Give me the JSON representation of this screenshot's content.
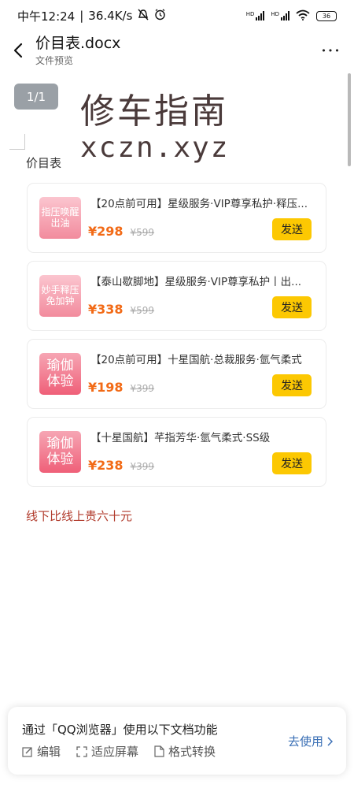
{
  "status_bar": {
    "time": "中午12:24",
    "speed": "36.4K/s",
    "hd1": "HD",
    "hd2": "HD",
    "battery": "36"
  },
  "app_bar": {
    "title": "价目表.docx",
    "subtitle": "文件预览",
    "more_label": "•••"
  },
  "document": {
    "page_indicator": "1/1",
    "watermark_cn": "修车指南",
    "watermark_en": "xczn.xyz",
    "heading": "价目表",
    "items": [
      {
        "thumb_text": "指压唤醒\n出油",
        "title": "【20点前可用】星级服务·VIP尊享私护·释压...",
        "price": "¥298",
        "original_price": "¥599",
        "button": "发送"
      },
      {
        "thumb_text": "妙手释压\n免加钟",
        "title": "【泰山歇脚地】星级服务·VIP尊享私护丨出...",
        "price": "¥338",
        "original_price": "¥599",
        "button": "发送"
      },
      {
        "thumb_text": "瑜伽\n体验",
        "title": "【20点前可用】十星国航·总裁服务·氫气柔式",
        "price": "¥198",
        "original_price": "¥399",
        "button": "发送"
      },
      {
        "thumb_text": "瑜伽\n体验",
        "title": "【十星国航】芊指芳华·氫气柔式·SS级",
        "price": "¥238",
        "original_price": "¥399",
        "button": "发送"
      }
    ],
    "footer_note": "线下比线上贵六十元"
  },
  "promo": {
    "text": "通过「QQ浏览器」使用以下文档功能",
    "actions": [
      "编辑",
      "适应屏幕",
      "格式转换"
    ],
    "use_label": "去使用"
  },
  "colors": {
    "price": "#f26a16",
    "button": "#fcc802",
    "footer_note": "#b13b2c",
    "link": "#3a6fb5"
  }
}
